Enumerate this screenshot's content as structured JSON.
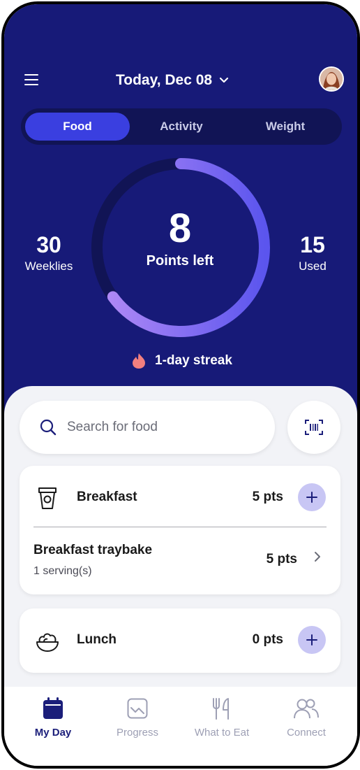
{
  "header": {
    "date_label": "Today, Dec 08",
    "menu_icon": "hamburger-menu-icon",
    "avatar": "user-avatar"
  },
  "tabs": [
    {
      "label": "Food",
      "active": true
    },
    {
      "label": "Activity",
      "active": false
    },
    {
      "label": "Weight",
      "active": false
    }
  ],
  "points": {
    "weeklies_value": "30",
    "weeklies_label": "Weeklies",
    "points_left_value": "8",
    "points_left_label": "Points left",
    "used_value": "15",
    "used_label": "Used",
    "ring_progress_fraction": 0.65
  },
  "streak": {
    "label": "1-day streak",
    "icon": "flame-icon"
  },
  "search": {
    "placeholder": "Search for food",
    "scan_icon": "barcode-scan-icon"
  },
  "meals": {
    "breakfast": {
      "title": "Breakfast",
      "points": "5 pts",
      "items": [
        {
          "name": "Breakfast traybake",
          "serving": "1 serving(s)",
          "points": "5 pts"
        }
      ]
    },
    "lunch": {
      "title": "Lunch",
      "points": "0 pts"
    }
  },
  "bottom_nav": [
    {
      "label": "My Day",
      "icon": "calendar-icon",
      "active": true
    },
    {
      "label": "Progress",
      "icon": "chart-icon",
      "active": false
    },
    {
      "label": "What to Eat",
      "icon": "fork-knife-icon",
      "active": false
    },
    {
      "label": "Connect",
      "icon": "people-icon",
      "active": false
    }
  ],
  "colors": {
    "hero_bg": "#171a78",
    "active_tab": "#3a3fe0",
    "ring_gradient_start": "#b48cf6",
    "ring_gradient_end": "#5b55ee",
    "plus_button": "#c8c6f4",
    "streak_flame": "#f27f7f",
    "nav_active": "#1b1e7a"
  }
}
